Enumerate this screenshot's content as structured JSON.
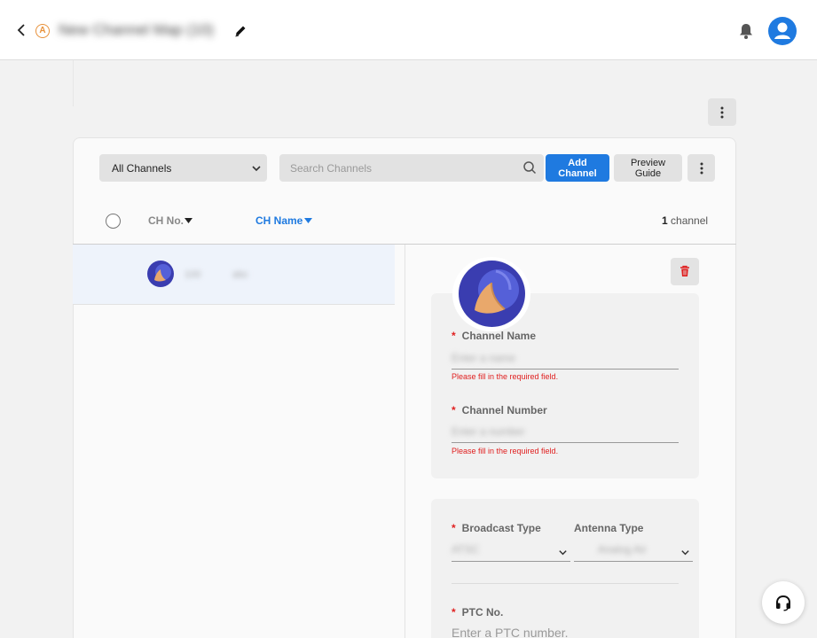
{
  "header": {
    "title": "New Channel Map (10)",
    "badge_letter": "A",
    "badge_color": "#e8913a"
  },
  "toolbar": {
    "filter_selected": "All Channels",
    "search_placeholder": "Search Channels",
    "add_channel_label": "Add\nChannel",
    "preview_guide_label": "Preview\nGuide"
  },
  "table": {
    "col_no": "CH No.",
    "col_name": "CH Name",
    "count_number": "1",
    "count_suffix": "channel",
    "rows": [
      {
        "no": "100",
        "name": "abc"
      }
    ]
  },
  "detail": {
    "channel_name_label": "Channel Name",
    "channel_name_value": "Enter a name",
    "channel_name_error": "Please fill in the required field.",
    "channel_number_label": "Channel Number",
    "channel_number_value": "Enter a number",
    "channel_number_error": "Please fill in the required field.",
    "broadcast_type_label": "Broadcast Type",
    "broadcast_type_value": "ATSC",
    "antenna_type_label": "Antenna Type",
    "antenna_type_value": "Analog Air",
    "ptc_label": "PTC No.",
    "ptc_placeholder": "Enter a PTC number."
  },
  "colors": {
    "accent": "#1f7ae0",
    "error": "#e02020",
    "logo_bg": "#3a3db0"
  }
}
